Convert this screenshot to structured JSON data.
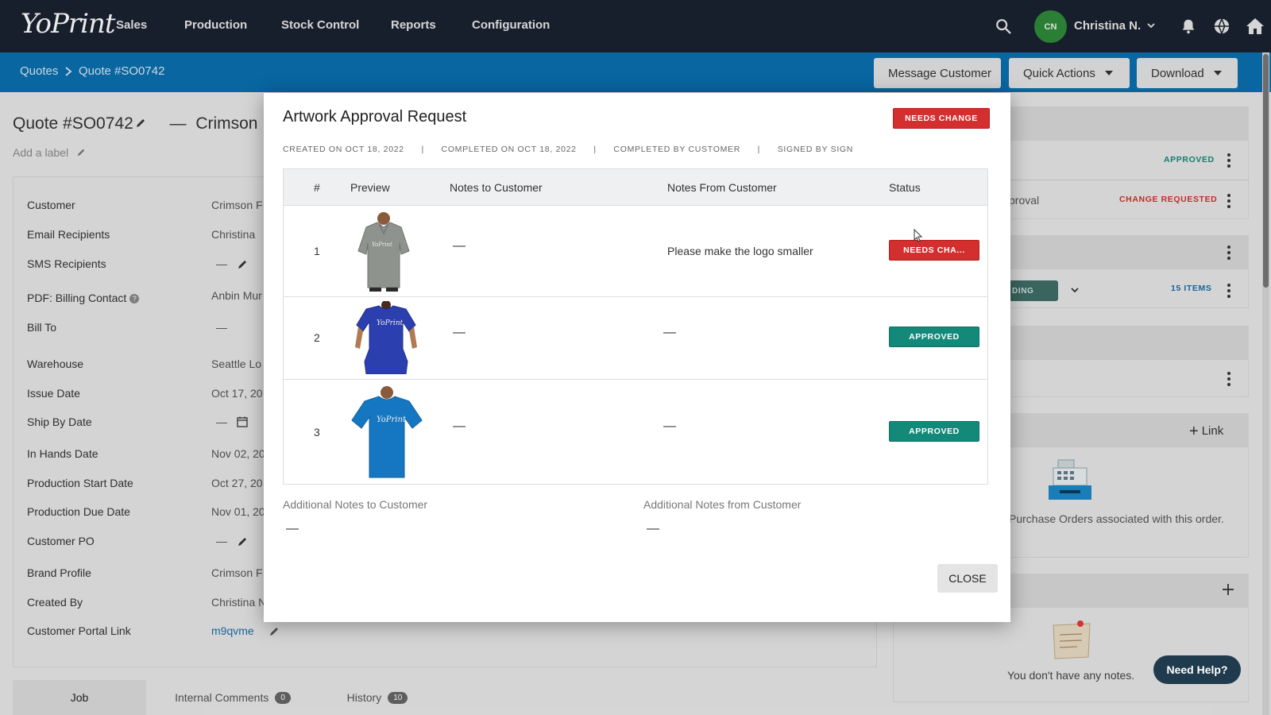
{
  "app": {
    "logo": "YoPrint"
  },
  "nav": {
    "items": [
      "Sales",
      "Production",
      "Stock Control",
      "Reports",
      "Configuration"
    ],
    "user_initials": "CN",
    "user_name": "Christina N."
  },
  "breadcrumb": {
    "root": "Quotes",
    "current": "Quote #SO0742"
  },
  "actions": {
    "message_customer": "Message Customer",
    "quick_actions": "Quick Actions",
    "download": "Download"
  },
  "page": {
    "title": "Quote #SO0742",
    "title_dash": "—",
    "title_customer": "Crimson Flo",
    "add_label": "Add a label"
  },
  "details": {
    "fields": [
      {
        "label": "Customer",
        "value": "Crimson F"
      },
      {
        "label": "Email Recipients",
        "value": "Christina"
      },
      {
        "label": "SMS Recipients",
        "value": "—"
      },
      {
        "label": "PDF: Billing Contact",
        "value": "Anbin Mur"
      },
      {
        "label": "Bill To",
        "value": "—"
      },
      {
        "label": "Warehouse",
        "value": "Seattle Lo"
      },
      {
        "label": "Issue Date",
        "value": "Oct 17, 20"
      },
      {
        "label": "Ship By Date",
        "value": "—"
      },
      {
        "label": "In Hands Date",
        "value": "Nov 02, 20"
      },
      {
        "label": "Production Start Date",
        "value": "Oct 27, 20"
      },
      {
        "label": "Production Due Date",
        "value": "Nov 01, 20"
      },
      {
        "label": "Customer PO",
        "value": "—"
      },
      {
        "label": "Brand Profile",
        "value": "Crimson F"
      },
      {
        "label": "Created By",
        "value": "Christina N"
      },
      {
        "label": "Customer Portal Link",
        "value": "m9qvme"
      }
    ]
  },
  "tabs": {
    "job": "Job",
    "internal_comments": "Internal Comments",
    "internal_comments_count": "0",
    "history": "History",
    "history_count": "10"
  },
  "right_panel": {
    "approved": "APPROVED",
    "approval_text": "proval",
    "change_requested": "CHANGE REQUESTED",
    "ding": "DING",
    "items_count": "15 ITEMS",
    "link": "Link",
    "po_text": "Purchase Orders associated with this order.",
    "notes_empty": "You don't have any notes."
  },
  "help": {
    "label": "Need Help?"
  },
  "modal": {
    "title": "Artwork Approval Request",
    "status_badge": "NEEDS CHANGE",
    "meta": {
      "created": "CREATED ON OCT 18, 2022",
      "completed": "COMPLETED ON OCT 18, 2022",
      "completed_by": "COMPLETED BY CUSTOMER",
      "signed_by": "SIGNED BY SIGN",
      "separator": "|"
    },
    "columns": [
      "#",
      "Preview",
      "Notes to Customer",
      "Notes From Customer",
      "Status"
    ],
    "rows": [
      {
        "num": "1",
        "notes_to": "—",
        "notes_from": "Please make the logo smaller",
        "status": "NEEDS CHA...",
        "status_color": "#d32f2f",
        "shirt_color": "#8e938e",
        "shirt_type": "polo"
      },
      {
        "num": "2",
        "notes_to": "—",
        "notes_from": "—",
        "status": "APPROVED",
        "status_color": "#13897a",
        "shirt_color": "#2b3fae",
        "shirt_type": "womens-tee"
      },
      {
        "num": "3",
        "notes_to": "—",
        "notes_from": "—",
        "status": "APPROVED",
        "status_color": "#13897a",
        "shirt_color": "#1577c2",
        "shirt_type": "tee"
      }
    ],
    "additional_to_label": "Additional Notes to Customer",
    "additional_to_value": "—",
    "additional_from_label": "Additional Notes from Customer",
    "additional_from_value": "—",
    "close": "CLOSE"
  }
}
